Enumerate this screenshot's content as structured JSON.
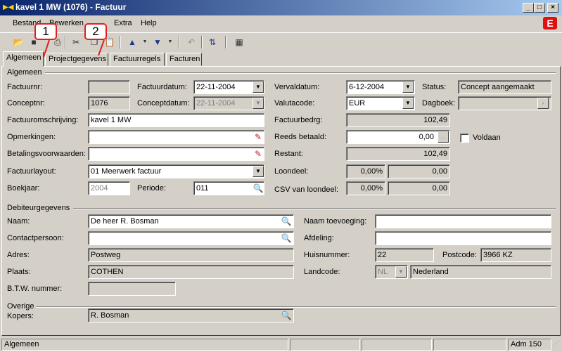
{
  "window": {
    "title": "kavel 1 MW (1076) - Factuur"
  },
  "menu": {
    "bestand": "Bestand",
    "bewerken": "Bewerken",
    "extra": "Extra",
    "help": "Help"
  },
  "icons": {
    "brand": "E"
  },
  "tabs": [
    "Algemeen",
    "Projectgegevens",
    "Factuurregels",
    "Facturen"
  ],
  "callouts": [
    "1",
    "2"
  ],
  "algemeen": {
    "section": "Algemeen",
    "factuurnr": {
      "label": "Factuurnr:",
      "value": ""
    },
    "factuurdatum": {
      "label": "Factuurdatum:",
      "value": "22-11-2004"
    },
    "vervaldatum": {
      "label": "Vervaldatum:",
      "value": "6-12-2004"
    },
    "status": {
      "label": "Status:",
      "value": "Concept aangemaakt"
    },
    "conceptnr": {
      "label": "Conceptnr:",
      "value": "1076"
    },
    "conceptdatum": {
      "label": "Conceptdatum:",
      "value": "22-11-2004"
    },
    "valutacode": {
      "label": "Valutacode:",
      "value": "EUR"
    },
    "dagboek": {
      "label": "Dagboek:",
      "value": ""
    },
    "factuuromschrijving": {
      "label": "Factuuromschrijving:",
      "value": "kavel 1 MW"
    },
    "factuurbedrg": {
      "label": "Factuurbedrg:",
      "value": "102,49"
    },
    "opmerkingen": {
      "label": "Opmerkingen:",
      "value": ""
    },
    "reeds_betaald": {
      "label": "Reeds betaald:",
      "value": "0,00"
    },
    "voldaan": {
      "label": "Voldaan"
    },
    "betalingsvoorwaarden": {
      "label": "Betalingsvoorwaarden:",
      "value": ""
    },
    "restant": {
      "label": "Restant:",
      "value": "102,49"
    },
    "factuurlayout": {
      "label": "Factuurlayout:",
      "value": "01 Meerwerk factuur"
    },
    "loondeel": {
      "label": "Loondeel:",
      "pct": "0,00%",
      "value": "0,00"
    },
    "boekjaar": {
      "label": "Boekjaar:",
      "value": "2004"
    },
    "periode": {
      "label": "Periode:",
      "value": "011"
    },
    "csv": {
      "label": "CSV van loondeel:",
      "pct": "0,00%",
      "value": "0,00"
    }
  },
  "debiteur": {
    "section": "Debiteurgegevens",
    "naam": {
      "label": "Naam:",
      "value": "De heer R. Bosman"
    },
    "naam_toevoeging": {
      "label": "Naam toevoeging:",
      "value": ""
    },
    "contactpersoon": {
      "label": "Contactpersoon:",
      "value": ""
    },
    "afdeling": {
      "label": "Afdeling:",
      "value": ""
    },
    "adres": {
      "label": "Adres:",
      "value": "Postweg"
    },
    "huisnummer": {
      "label": "Huisnummer:",
      "value": "22"
    },
    "postcode": {
      "label": "Postcode:",
      "value": "3966 KZ"
    },
    "plaats": {
      "label": "Plaats:",
      "value": "COTHEN"
    },
    "landcode": {
      "label": "Landcode:",
      "code": "NL",
      "value": "Nederland"
    },
    "btw": {
      "label": "B.T.W. nummer:",
      "value": ""
    }
  },
  "overige": {
    "section": "Overige",
    "kopers": {
      "label": "Kopers:",
      "value": "R. Bosman"
    }
  },
  "statusbar": {
    "left": "Algemeen",
    "right": "Adm 150"
  }
}
